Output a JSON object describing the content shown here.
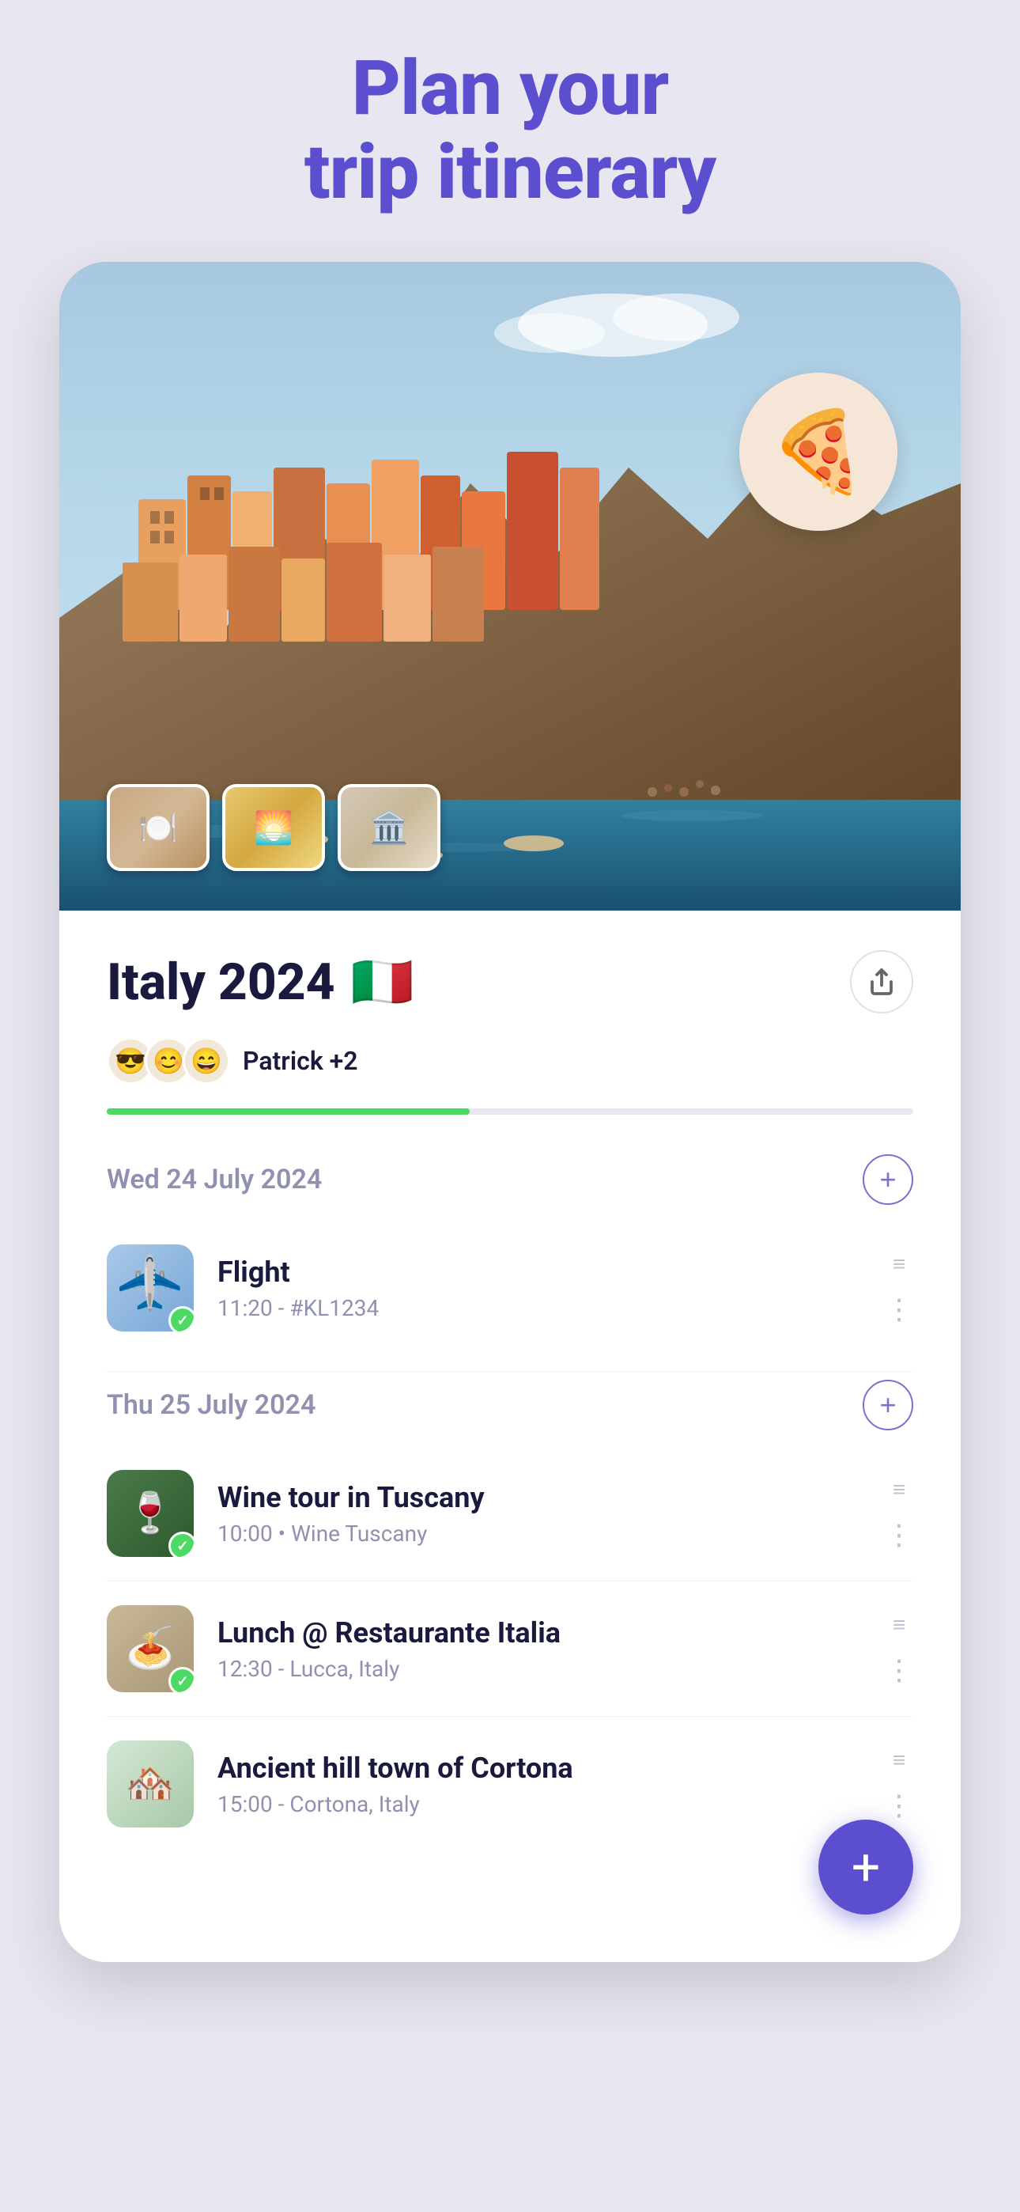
{
  "hero": {
    "title_line1": "Plan your",
    "title_line2": "trip itinerary",
    "pizza_emoji": "🍕"
  },
  "trip": {
    "name": "Italy 2024",
    "flag": "🇮🇹",
    "collaborators": {
      "names": "Patrick +2",
      "avatars": [
        "😎",
        "😊",
        "😄"
      ]
    },
    "progress_percent": 45
  },
  "days": [
    {
      "label": "Wed 24 July 2024",
      "activities": [
        {
          "name": "Flight",
          "meta": "11:20 - #KL1234",
          "icon": "✈️",
          "thumb_type": "flight",
          "checked": true
        }
      ]
    },
    {
      "label": "Thu 25 July 2024",
      "activities": [
        {
          "name": "Wine tour in Tuscany",
          "meta": "10:00 • Wine Tuscany",
          "icon": "🍷",
          "thumb_type": "wine",
          "checked": true
        },
        {
          "name": "Lunch @ Restaurante Italia",
          "meta": "12:30 - Lucca, Italy",
          "icon": "🍝",
          "thumb_type": "lunch",
          "checked": true
        },
        {
          "name": "Ancient hill town of Cortona",
          "meta": "15:00 - Cortona, Italy",
          "icon": "🏘️",
          "thumb_type": "cortona",
          "checked": false
        }
      ]
    }
  ],
  "fab_label": "+",
  "thumbnails": [
    {
      "icon": "🍽️",
      "label": "restaurant thumbnail"
    },
    {
      "icon": "🌅",
      "label": "sunset thumbnail"
    },
    {
      "icon": "🏛️",
      "label": "colosseum thumbnail"
    }
  ]
}
